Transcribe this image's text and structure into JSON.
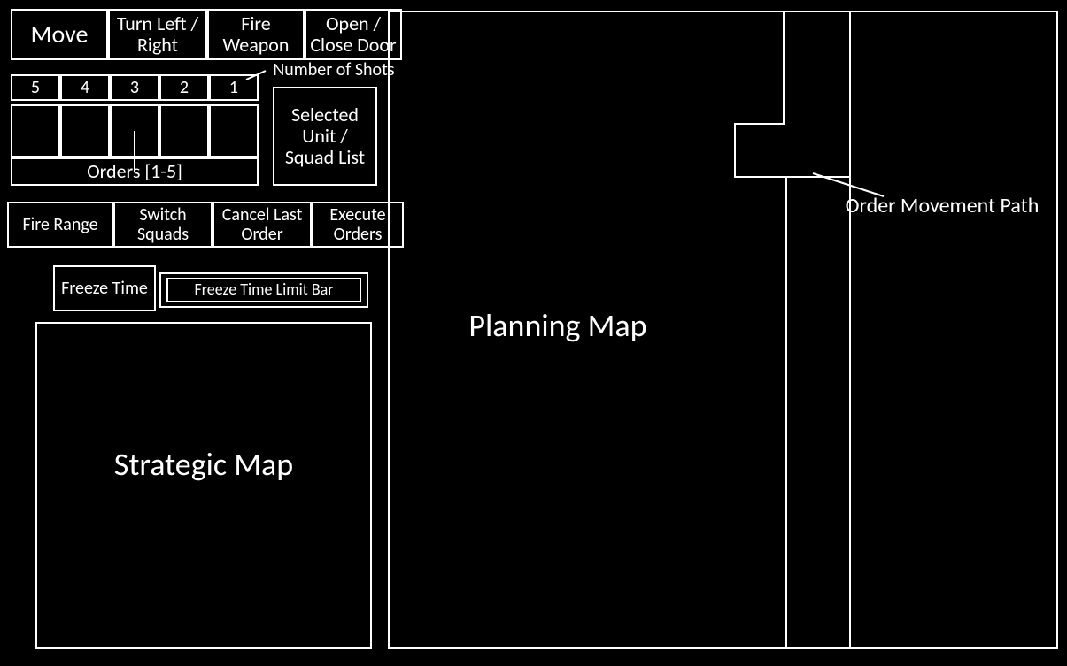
{
  "action_buttons": {
    "move": "Move",
    "turn": "Turn Left / Right",
    "fire_weapon": "Fire Weapon",
    "door": "Open / Close Door"
  },
  "shots": {
    "s5": "5",
    "s4": "4",
    "s3": "3",
    "s2": "2",
    "s1": "1"
  },
  "orders_caption": "Orders [1-5]",
  "number_of_shots_label": "Number of Shots",
  "selected_unit_label": "Selected Unit / Squad List",
  "command_buttons": {
    "fire_range": "Fire Range",
    "switch_squads": "Switch Squads",
    "cancel_last": "Cancel Last Order",
    "execute": "Execute Orders"
  },
  "freeze_time_label": "Freeze Time",
  "freeze_bar_label": "Freeze Time Limit Bar",
  "strategic_map_label": "Strategic Map",
  "planning_map_label": "Planning Map",
  "order_movement_path_label": "Order Movement Path"
}
